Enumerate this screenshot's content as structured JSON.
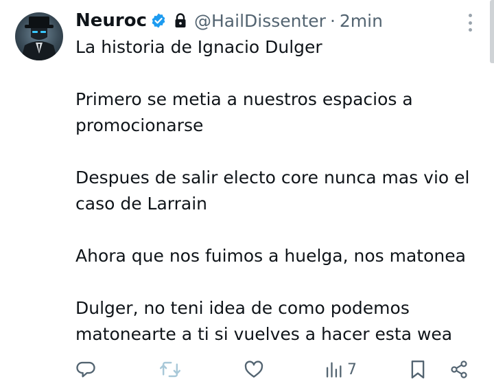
{
  "tweet": {
    "author_name": "Neuroc",
    "handle": "@HailDissenter",
    "separator": "·",
    "time": "2min",
    "lines": [
      "La historia de Ignacio Dulger",
      "",
      "Primero se metia a nuestros espacios a",
      "promocionarse",
      "",
      "Despues de salir electo core nunca mas vio el",
      "caso de Larrain",
      "",
      "Ahora que nos fuimos a huelga, nos matonea",
      "",
      "Dulger, no teni idea de como podemos",
      "matonearte a ti si vuelves a hacer esta wea"
    ]
  },
  "actions": {
    "reply_icon": "reply-icon",
    "retweet_icon": "retweet-icon",
    "like_icon": "heart-icon",
    "views_icon": "views-chart-icon",
    "views_count": "7",
    "bookmark_icon": "bookmark-icon",
    "share_icon": "share-icon"
  },
  "colors": {
    "text": "#0f1419",
    "muted": "#536471",
    "verified": "#1d9bf0",
    "retweet_disabled": "#a8c8d8"
  }
}
